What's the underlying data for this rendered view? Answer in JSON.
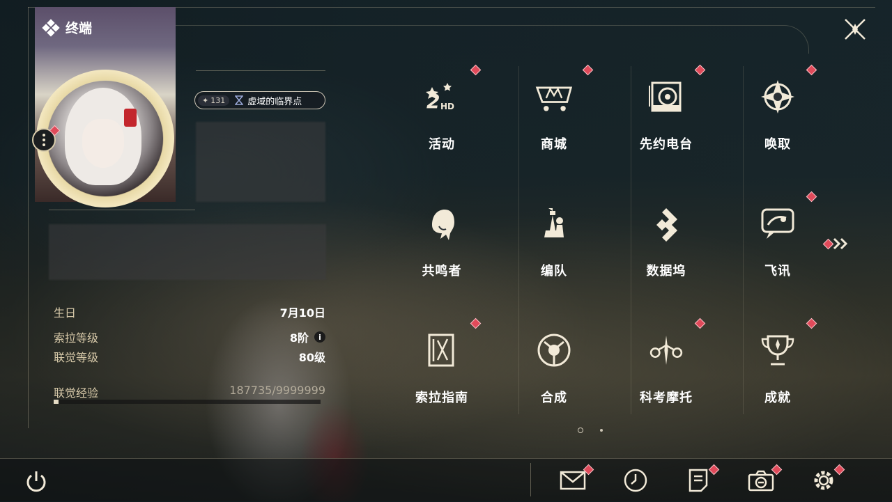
{
  "panel": {
    "title": "终端",
    "title_icon": "diamond-cluster-icon",
    "close_icon": "close-x-icon"
  },
  "profile": {
    "tag_count": "131",
    "tag_icon": "sparkle-icon",
    "tag_text": "虚域的临界点",
    "tag_text_icon": "hourglass-icon",
    "menu_icon": "more-vertical-icon"
  },
  "info": {
    "birthday_label": "生日",
    "birthday_value": "7月10日",
    "sola_level_label": "索拉等级",
    "sola_level_value": "8阶",
    "union_level_label": "联觉等级",
    "union_level_value": "80级",
    "exp_label": "联觉经验",
    "exp_value": "187735/9999999",
    "exp_progress": 0.019
  },
  "menu": {
    "tiles": [
      {
        "label": "活动",
        "icon": "event-2hd-icon",
        "badge": true
      },
      {
        "label": "商城",
        "icon": "shopping-cart-icon",
        "badge": true
      },
      {
        "label": "先约电台",
        "icon": "radio-icon",
        "badge": true
      },
      {
        "label": "唤取",
        "icon": "compass-star-icon",
        "badge": true
      },
      {
        "label": "共鸣者",
        "icon": "character-head-icon",
        "badge": false
      },
      {
        "label": "编队",
        "icon": "chess-pieces-icon",
        "badge": false
      },
      {
        "label": "数据坞",
        "icon": "data-dock-icon",
        "badge": false
      },
      {
        "label": "飞讯",
        "icon": "message-bubble-icon",
        "badge": true
      },
      {
        "label": "索拉指南",
        "icon": "guide-book-icon",
        "badge": true
      },
      {
        "label": "合成",
        "icon": "synthesis-icon",
        "badge": false
      },
      {
        "label": "科考摩托",
        "icon": "motorcycle-icon",
        "badge": true
      },
      {
        "label": "成就",
        "icon": "trophy-icon",
        "badge": true
      }
    ],
    "next_page_icon": "double-chevron-right-icon",
    "page_indicator": {
      "current": 1,
      "total": 2
    }
  },
  "bottom_bar": {
    "power_icon": "power-icon",
    "items": [
      {
        "icon": "mail-icon",
        "badge": true
      },
      {
        "icon": "clock-icon",
        "badge": false
      },
      {
        "icon": "notice-icon",
        "badge": true
      },
      {
        "icon": "camera-icon",
        "badge": true
      },
      {
        "icon": "settings-gear-icon",
        "badge": true
      }
    ]
  },
  "colors": {
    "badge": "#e04a5a",
    "accent_gold": "#e5dcc5",
    "label_gold": "#d6c8a8"
  }
}
